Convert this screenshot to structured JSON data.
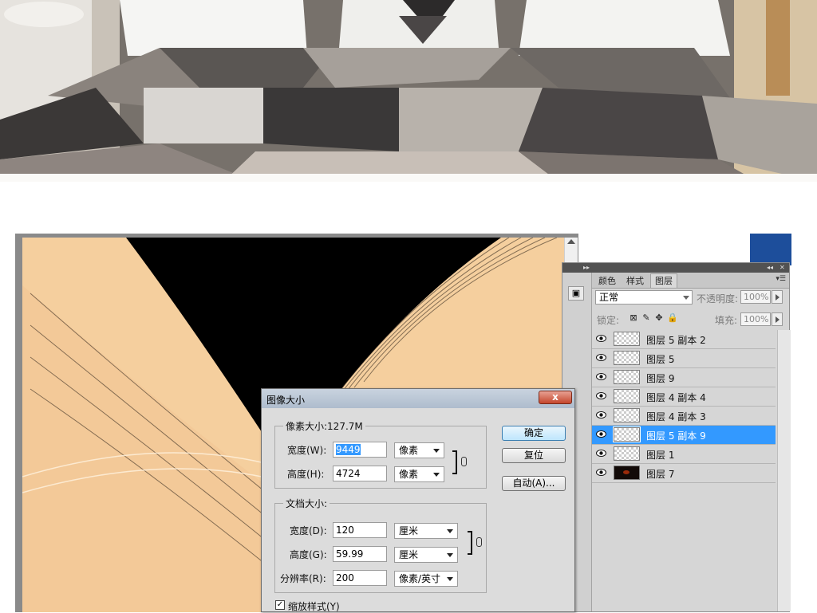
{
  "dialog": {
    "title": "图像大小",
    "pixel_group_label": "像素大小:127.7M",
    "width_label": "宽度(W):",
    "width_value": "9449",
    "width_unit": "像素",
    "height_label": "高度(H):",
    "height_value": "4724",
    "height_unit": "像素",
    "doc_group_label": "文档大小:",
    "doc_width_label": "宽度(D):",
    "doc_width_value": "120",
    "doc_width_unit": "厘米",
    "doc_height_label": "高度(G):",
    "doc_height_value": "59.99",
    "doc_height_unit": "厘米",
    "resolution_label": "分辨率(R):",
    "resolution_value": "200",
    "resolution_unit": "像素/英寸",
    "scale_styles_label": "缩放样式(Y)",
    "scale_styles_checked": true,
    "ok_label": "确定",
    "reset_label": "复位",
    "auto_label": "自动(A)...",
    "close_label": "x"
  },
  "layers_panel": {
    "tabs": [
      "颜色",
      "样式",
      "图层"
    ],
    "active_tab": "图层",
    "blend_mode": "正常",
    "opacity_label": "不透明度:",
    "opacity_value": "100%",
    "lock_label": "锁定:",
    "fill_label": "填充:",
    "fill_value": "100%",
    "layers": [
      {
        "name": "图层 5 副本 2",
        "thumb": "transparent",
        "selected": false
      },
      {
        "name": "图层 5",
        "thumb": "transparent",
        "selected": false
      },
      {
        "name": "图层 9",
        "thumb": "transparent",
        "selected": false
      },
      {
        "name": "图层 4 副本 4",
        "thumb": "transparent",
        "selected": false
      },
      {
        "name": "图层 4 副本 3",
        "thumb": "transparent",
        "selected": false
      },
      {
        "name": "图层 5 副本 9",
        "thumb": "transparent",
        "selected": true
      },
      {
        "name": "图层 1",
        "thumb": "transparent",
        "selected": false
      },
      {
        "name": "图层 7",
        "thumb": "dark",
        "selected": false
      }
    ]
  },
  "colors": {
    "selection": "#3399ff",
    "canvas_peach": "#f5cf9e",
    "canvas_black": "#000000",
    "close_red": "#c4462d"
  }
}
